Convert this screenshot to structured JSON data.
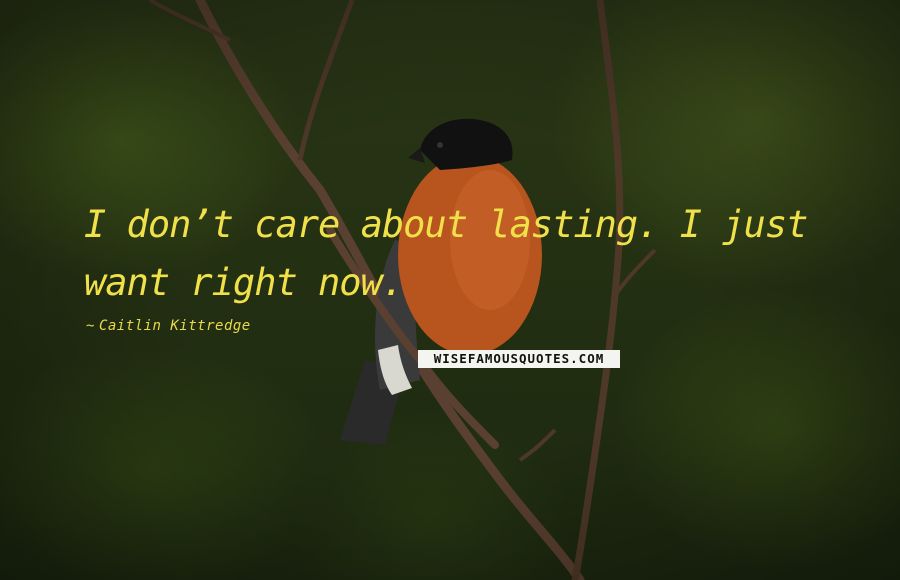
{
  "quote": {
    "text": "I don’t care about lasting. I just want right now.",
    "author": "Caitlin Kittredge",
    "author_prefix": "~"
  },
  "watermark": {
    "text": "WISEFAMOUSQUOTES.COM"
  },
  "colors": {
    "quote_text": "#f0e04a",
    "background": "#243012",
    "bird_breast": "#b8541e",
    "bird_cap": "#111111"
  }
}
